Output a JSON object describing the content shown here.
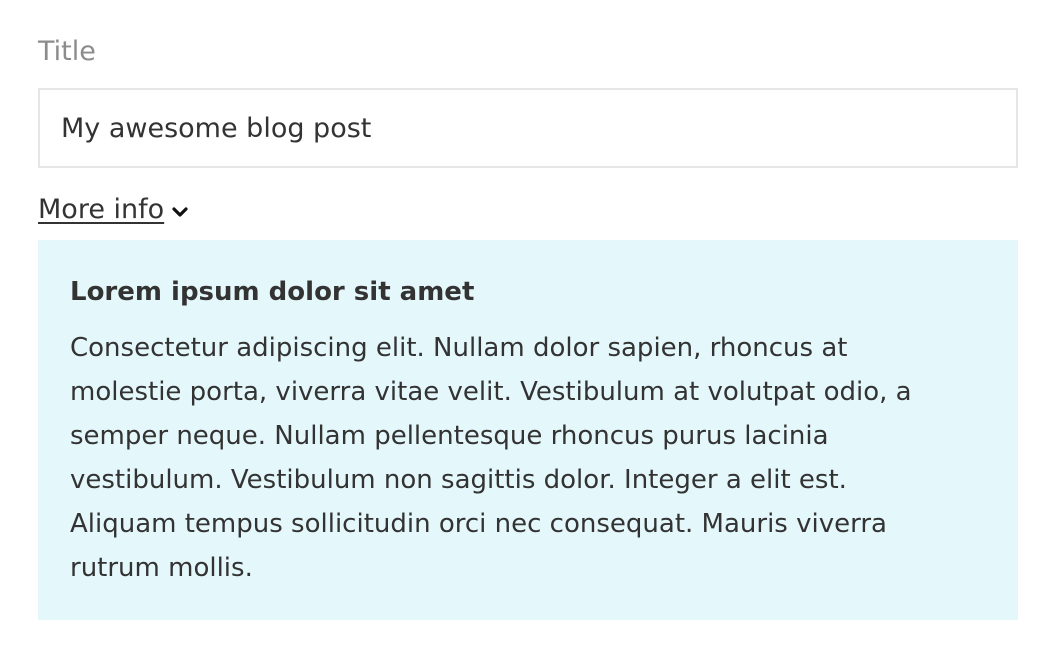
{
  "form": {
    "title_label": "Title",
    "title_value": "My awesome blog post",
    "more_info_label": "More info",
    "more_info_icon": "chevron-down-icon"
  },
  "info_panel": {
    "heading": "Lorem ipsum dolor sit amet",
    "body": "Consectetur adipiscing elit. Nullam dolor sapien, rhoncus at molestie porta, viverra vitae velit. Vestibulum at volutpat odio, a semper neque. Nullam pellentesque rhoncus purus lacinia vestibulum. Vestibulum non sagittis dolor. Integer a elit est. Aliquam tempus sollicitudin orci nec consequat. Mauris viverra rutrum mollis."
  },
  "colors": {
    "label": "#8c8c8c",
    "text": "#333333",
    "input_border": "#e6e6e6",
    "panel_background": "#e4f7fb"
  }
}
